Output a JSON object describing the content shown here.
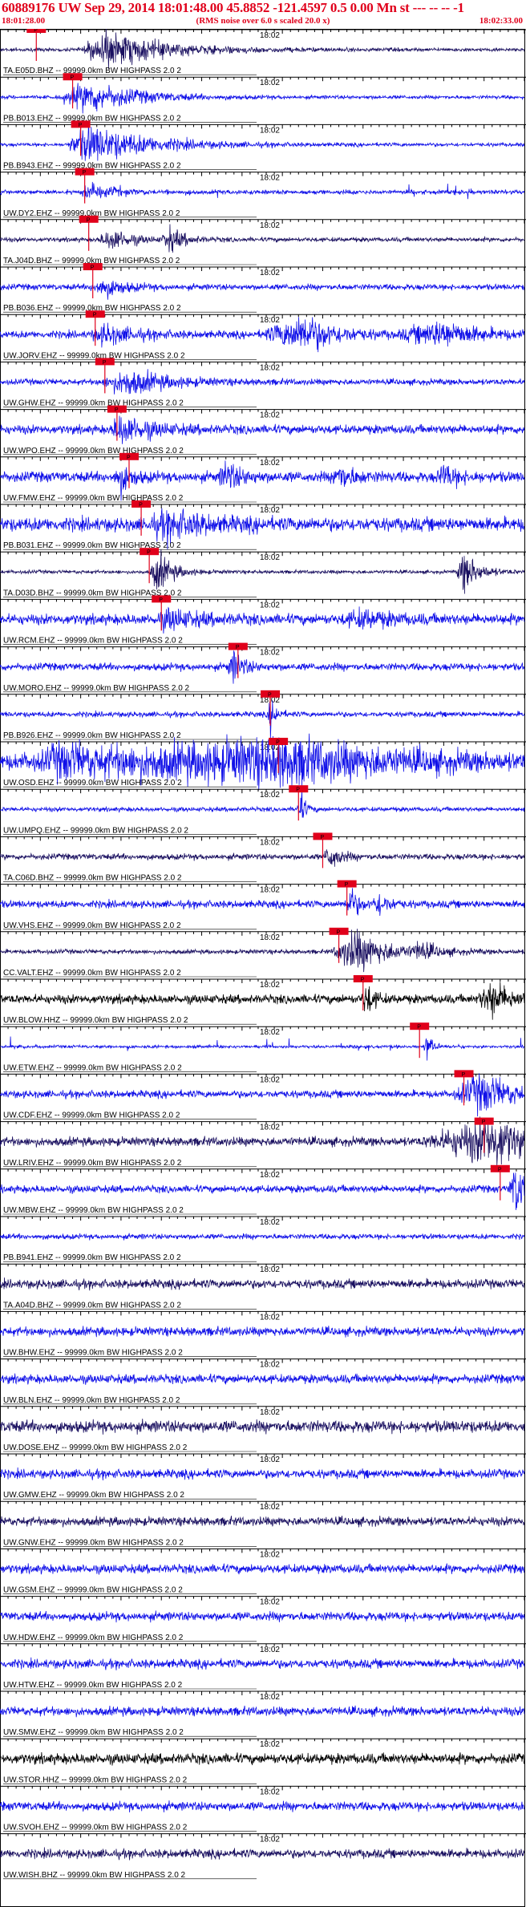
{
  "header": {
    "title": "60889176 UW Sep 29, 2014 18:01:48.00   45.8852 -121.4597  0.5 0.00 Mn st --- -- --  -1",
    "start_time": "18:01:28.00",
    "rms_note": "(RMS noise over 6.0 s scaled 20.0 x)",
    "end_time": "18:02:33.00"
  },
  "colors": {
    "header_text": "#e0001b",
    "trace_blue": "#1010e8",
    "trace_navy": "#1a1060",
    "trace_black": "#000000",
    "pick_box": "#e0001b",
    "pick_line": "#e0001b"
  },
  "chart_data": {
    "type": "seismogram",
    "x_start": "18:01:28.00",
    "x_end": "18:02:33.00",
    "x_unit": "s",
    "x_range": [
      0,
      65
    ],
    "minute_tick_label": "18:02",
    "minute_tick_time_s": 32,
    "pick_label": "P",
    "channels": [
      {
        "name": "TA.E05D.BHZ -- 99999.0km BW  HIGHPASS  2.0  2",
        "color": "#1a1060",
        "pick_s": 4.5,
        "bursts": [
          [
            13,
            12,
            1.2,
            3
          ]
        ],
        "noise": 0.12
      },
      {
        "name": "PB.B013.EHZ -- 99999.0km BW  HIGHPASS  2.0  2",
        "color": "#1010e8",
        "pick_s": 9.0,
        "bursts": [
          [
            11,
            10,
            1.0,
            4
          ]
        ],
        "noise": 0.12
      },
      {
        "name": "PB.B943.EHZ -- 99999.0km BW  HIGHPASS  2.0  2",
        "color": "#1010e8",
        "pick_s": 10.0,
        "bursts": [
          [
            11,
            12,
            1.3,
            3
          ]
        ],
        "noise": 0.12
      },
      {
        "name": "UW.DY2.EHZ -- 99999.0km BW  HIGHPASS  2.0  2",
        "color": "#1010e8",
        "pick_s": 10.5,
        "bursts": [
          [
            11,
            4,
            0.6,
            1
          ]
        ],
        "noise": 0.15,
        "spikes": 1
      },
      {
        "name": "TA.J04D.BHZ -- 99999.0km BW  HIGHPASS  2.0  2",
        "color": "#1a1060",
        "pick_s": 11.0,
        "bursts": [
          [
            14,
            4,
            0.7,
            2
          ],
          [
            21,
            3,
            0.8,
            1
          ]
        ],
        "noise": 0.15
      },
      {
        "name": "PB.B036.EHZ -- 99999.0km BW  HIGHPASS  2.0  2",
        "color": "#1010e8",
        "pick_s": 11.5,
        "bursts": [
          [
            13,
            4,
            0.6,
            2
          ]
        ],
        "noise": 0.2
      },
      {
        "name": "UW.JORV.EHZ -- 99999.0km BW  HIGHPASS  2.0  2",
        "color": "#1010e8",
        "pick_s": 11.8,
        "bursts": [
          [
            13,
            6,
            0.6,
            2
          ],
          [
            38,
            6,
            1.2,
            6
          ],
          [
            55,
            7,
            0.8,
            6
          ]
        ],
        "noise": 0.25
      },
      {
        "name": "UW.GHW.EHZ -- 99999.0km BW  HIGHPASS  2.0  2",
        "color": "#1010e8",
        "pick_s": 13.0,
        "bursts": [
          [
            16,
            8,
            0.8,
            4
          ]
        ],
        "noise": 0.2
      },
      {
        "name": "UW.WPO.EHZ -- 99999.0km BW  HIGHPASS  2.0  2",
        "color": "#1010e8",
        "pick_s": 14.5,
        "bursts": [
          [
            15,
            6,
            0.9,
            1.5
          ]
        ],
        "noise": 0.3
      },
      {
        "name": "UW.FMW.EHZ -- 99999.0km BW  HIGHPASS  2.0  2",
        "color": "#1010e8",
        "pick_s": 16.0,
        "bursts": [
          [
            15,
            2,
            1.0,
            1
          ],
          [
            28,
            3,
            0.9,
            1
          ],
          [
            42,
            3,
            0.8,
            1
          ],
          [
            55,
            3,
            0.7,
            1
          ]
        ],
        "noise": 0.35
      },
      {
        "name": "PB.B031.EHZ -- 99999.0km BW  HIGHPASS  2.0  2",
        "color": "#1010e8",
        "pick_s": 17.5,
        "bursts": [
          [
            21,
            8,
            0.8,
            3
          ]
        ],
        "noise": 0.45
      },
      {
        "name": "TA.D03D.BHZ -- 99999.0km BW  HIGHPASS  2.0  2",
        "color": "#1a1060",
        "pick_s": 18.5,
        "bursts": [
          [
            19.5,
            3,
            1.4,
            1
          ],
          [
            57.5,
            3,
            1.4,
            1
          ]
        ],
        "noise": 0.12
      },
      {
        "name": "UW.RCM.EHZ -- 99999.0km BW  HIGHPASS  2.0  2",
        "color": "#1010e8",
        "pick_s": 20.0,
        "bursts": [
          [
            21,
            6,
            0.6,
            2
          ],
          [
            45,
            6,
            0.5,
            3
          ]
        ],
        "noise": 0.35
      },
      {
        "name": "UW.MORO.EHZ -- 99999.0km BW  HIGHPASS  2.0  2",
        "color": "#1010e8",
        "pick_s": 29.5,
        "bursts": [
          [
            29,
            2,
            1.0,
            1
          ]
        ],
        "noise": 0.25
      },
      {
        "name": "PB.B926.EHZ -- 99999.0km BW  HIGHPASS  2.0  2",
        "color": "#1010e8",
        "pick_s": 33.5,
        "bursts": [
          [
            33.6,
            1,
            1.3,
            0.5
          ]
        ],
        "noise": 0.18
      },
      {
        "name": "UW.OSD.EHZ -- 99999.0km BW  HIGHPASS  2.0  2",
        "color": "#1010e8",
        "pick_s": 34.5,
        "bursts": [
          [
            8,
            6,
            0.8,
            3
          ],
          [
            36,
            28,
            1.5,
            40
          ]
        ],
        "noise": 0.35
      },
      {
        "name": "UW.UMPQ.EHZ -- 99999.0km BW  HIGHPASS  2.0  2",
        "color": "#1010e8",
        "pick_s": 37.0,
        "bursts": [
          [
            37.2,
            1,
            1.3,
            0.5
          ]
        ],
        "noise": 0.15
      },
      {
        "name": "TA.C06D.BHZ -- 99999.0km BW  HIGHPASS  2.0  2",
        "color": "#1a1060",
        "pick_s": 40.0,
        "bursts": [
          [
            41,
            2,
            0.8,
            1
          ]
        ],
        "noise": 0.2
      },
      {
        "name": "UW.VHS.EHZ -- 99999.0km BW  HIGHPASS  2.0  2",
        "color": "#1010e8",
        "pick_s": 43.0,
        "bursts": [
          [
            43.5,
            1.5,
            1.1,
            0.8
          ],
          [
            47,
            2,
            0.7,
            1
          ]
        ],
        "noise": 0.25
      },
      {
        "name": "CC.VALT.EHZ -- 99999.0km BW  HIGHPASS  2.0  2",
        "color": "#1a1060",
        "pick_s": 42.0,
        "bursts": [
          [
            44,
            7,
            1.4,
            3
          ],
          [
            52,
            3,
            0.5,
            1
          ]
        ],
        "noise": 0.15
      },
      {
        "name": "UW.BLOW.HHZ -- 99999.0km BW  HIGHPASS  2.0  2",
        "color": "#000000",
        "pick_s": 45.0,
        "bursts": [
          [
            45.5,
            1.5,
            1.0,
            0.8
          ],
          [
            61,
            4,
            1.1,
            2
          ]
        ],
        "noise": 0.3
      },
      {
        "name": "UW.ETW.EHZ -- 99999.0km BW  HIGHPASS  2.0  2",
        "color": "#1010e8",
        "pick_s": 52.0,
        "bursts": [
          [
            53,
            1,
            0.9,
            0.5
          ]
        ],
        "noise": 0.1,
        "spikes": 1
      },
      {
        "name": "UW.CDF.EHZ -- 99999.0km BW  HIGHPASS  2.0  2",
        "color": "#1010e8",
        "pick_s": 57.5,
        "bursts": [
          [
            60,
            6,
            1.3,
            4
          ]
        ],
        "noise": 0.25
      },
      {
        "name": "UW.LRIV.EHZ -- 99999.0km BW  HIGHPASS  2.0  2",
        "color": "#1a1060",
        "pick_s": 60.0,
        "bursts": [
          [
            62,
            5,
            1.6,
            10
          ]
        ],
        "noise": 0.3
      },
      {
        "name": "UW.MBW.EHZ -- 99999.0km BW  HIGHPASS  2.0  2",
        "color": "#1010e8",
        "pick_s": 62.0,
        "bursts": [
          [
            64,
            2,
            1.8,
            1
          ]
        ],
        "noise": 0.25
      },
      {
        "name": "PB.B941.EHZ -- 99999.0km BW  HIGHPASS  2.0  2",
        "color": "#1010e8",
        "bursts": [],
        "noise": 0.18
      },
      {
        "name": "TA.A04D.BHZ -- 99999.0km BW  HIGHPASS  2.0  2",
        "color": "#1a1060",
        "bursts": [],
        "noise": 0.3
      },
      {
        "name": "UW.BHW.EHZ -- 99999.0km BW  HIGHPASS  2.0  2",
        "color": "#1010e8",
        "bursts": [],
        "noise": 0.3
      },
      {
        "name": "UW.BLN.EHZ -- 99999.0km BW  HIGHPASS  2.0  2",
        "color": "#1010e8",
        "bursts": [],
        "noise": 0.3
      },
      {
        "name": "UW.DOSE.EHZ -- 99999.0km BW  HIGHPASS  2.0  2",
        "color": "#1a1060",
        "bursts": [],
        "noise": 0.4
      },
      {
        "name": "UW.GMW.EHZ -- 99999.0km BW  HIGHPASS  2.0  2",
        "color": "#1010e8",
        "bursts": [],
        "noise": 0.3
      },
      {
        "name": "UW.GNW.EHZ -- 99999.0km BW  HIGHPASS  2.0  2",
        "color": "#1a1060",
        "bursts": [],
        "noise": 0.3
      },
      {
        "name": "UW.GSM.EHZ -- 99999.0km BW  HIGHPASS  2.0  2",
        "color": "#1010e8",
        "bursts": [],
        "noise": 0.3
      },
      {
        "name": "UW.HDW.EHZ -- 99999.0km BW  HIGHPASS  2.0  2",
        "color": "#1010e8",
        "bursts": [],
        "noise": 0.3
      },
      {
        "name": "UW.HTW.EHZ -- 99999.0km BW  HIGHPASS  2.0  2",
        "color": "#1010e8",
        "bursts": [],
        "noise": 0.3
      },
      {
        "name": "UW.SMW.EHZ -- 99999.0km BW  HIGHPASS  2.0  2",
        "color": "#1010e8",
        "bursts": [],
        "noise": 0.3
      },
      {
        "name": "UW.STOR.HHZ -- 99999.0km BW  HIGHPASS  2.0  2",
        "color": "#000000",
        "bursts": [],
        "noise": 0.35
      },
      {
        "name": "UW.SVOH.EHZ -- 99999.0km BW  HIGHPASS  2.0  2",
        "color": "#1010e8",
        "bursts": [],
        "noise": 0.3
      },
      {
        "name": "UW.WISH.BHZ -- 99999.0km BW  HIGHPASS  2.0  2",
        "color": "#1a1060",
        "bursts": [],
        "noise": 0.3
      }
    ]
  }
}
